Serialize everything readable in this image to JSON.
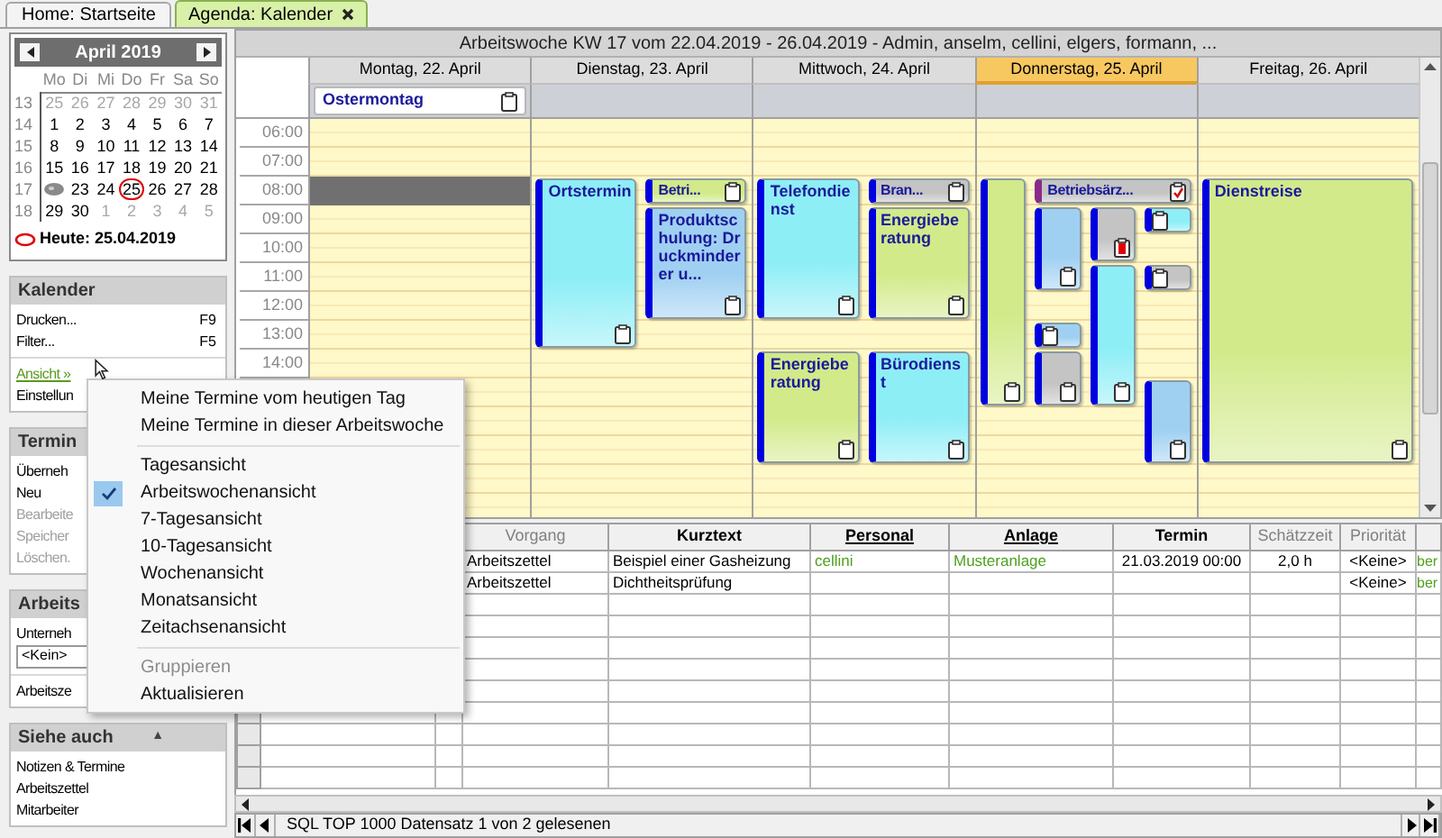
{
  "tabs": [
    {
      "label": "Home: Startseite",
      "selected": false,
      "closable": false
    },
    {
      "label": "Agenda: Kalender",
      "selected": true,
      "closable": true
    }
  ],
  "sidebar": {
    "mini_calendar": {
      "title": "April 2019",
      "weekdays": [
        "Mo",
        "Di",
        "Mi",
        "Do",
        "Fr",
        "Sa",
        "So"
      ],
      "weeks": [
        {
          "week": "13",
          "days": [
            {
              "kind": "day",
              "text": "25",
              "muted": true,
              "today": false
            },
            {
              "kind": "day",
              "text": "26",
              "muted": true,
              "today": false
            },
            {
              "kind": "day",
              "text": "27",
              "muted": true,
              "today": false
            },
            {
              "kind": "day",
              "text": "28",
              "muted": true,
              "today": false
            },
            {
              "kind": "day",
              "text": "29",
              "muted": true,
              "today": false
            },
            {
              "kind": "day",
              "text": "30",
              "muted": true,
              "today": false
            },
            {
              "kind": "day",
              "text": "31",
              "muted": true,
              "today": false
            }
          ]
        },
        {
          "week": "14",
          "days": [
            {
              "kind": "day",
              "text": "1",
              "muted": false,
              "today": false
            },
            {
              "kind": "day",
              "text": "2",
              "muted": false,
              "today": false
            },
            {
              "kind": "day",
              "text": "3",
              "muted": false,
              "today": false
            },
            {
              "kind": "day",
              "text": "4",
              "muted": false,
              "today": false
            },
            {
              "kind": "day",
              "text": "5",
              "muted": false,
              "today": false
            },
            {
              "kind": "day",
              "text": "6",
              "muted": false,
              "today": false
            },
            {
              "kind": "day",
              "text": "7",
              "muted": false,
              "today": false
            }
          ]
        },
        {
          "week": "15",
          "days": [
            {
              "kind": "day",
              "text": "8",
              "muted": false,
              "today": false
            },
            {
              "kind": "day",
              "text": "9",
              "muted": false,
              "today": false
            },
            {
              "kind": "day",
              "text": "10",
              "muted": false,
              "today": false
            },
            {
              "kind": "day",
              "text": "11",
              "muted": false,
              "today": false
            },
            {
              "kind": "day",
              "text": "12",
              "muted": false,
              "today": false
            },
            {
              "kind": "day",
              "text": "13",
              "muted": false,
              "today": false
            },
            {
              "kind": "day",
              "text": "14",
              "muted": false,
              "today": false
            }
          ]
        },
        {
          "week": "16",
          "days": [
            {
              "kind": "day",
              "text": "15",
              "muted": false,
              "today": false
            },
            {
              "kind": "day",
              "text": "16",
              "muted": false,
              "today": false
            },
            {
              "kind": "day",
              "text": "17",
              "muted": false,
              "today": false
            },
            {
              "kind": "day",
              "text": "18",
              "muted": false,
              "today": false
            },
            {
              "kind": "day",
              "text": "19",
              "muted": false,
              "today": false
            },
            {
              "kind": "day",
              "text": "20",
              "muted": false,
              "today": false
            },
            {
              "kind": "day",
              "text": "21",
              "muted": false,
              "today": false
            }
          ]
        },
        {
          "week": "17",
          "days": [
            {
              "kind": "marker"
            },
            {
              "kind": "day",
              "text": "23",
              "muted": false,
              "today": false
            },
            {
              "kind": "day",
              "text": "24",
              "muted": false,
              "today": false
            },
            {
              "kind": "day",
              "text": "25",
              "muted": false,
              "today": true
            },
            {
              "kind": "day",
              "text": "26",
              "muted": false,
              "today": false
            },
            {
              "kind": "day",
              "text": "27",
              "muted": false,
              "today": false
            },
            {
              "kind": "day",
              "text": "28",
              "muted": false,
              "today": false
            }
          ]
        },
        {
          "week": "18",
          "days": [
            {
              "kind": "day",
              "text": "29",
              "muted": false,
              "today": false
            },
            {
              "kind": "day",
              "text": "30",
              "muted": false,
              "today": false
            },
            {
              "kind": "day",
              "text": "1",
              "muted": true,
              "today": false
            },
            {
              "kind": "day",
              "text": "2",
              "muted": true,
              "today": false
            },
            {
              "kind": "day",
              "text": "3",
              "muted": true,
              "today": false
            },
            {
              "kind": "day",
              "text": "4",
              "muted": true,
              "today": false
            },
            {
              "kind": "day",
              "text": "5",
              "muted": true,
              "today": false
            }
          ]
        }
      ],
      "today_label": "Heute: 25.04.2019"
    },
    "sections": [
      {
        "title": "Kalender",
        "groups": [
          [
            {
              "kind": "action",
              "text": "Drucken...",
              "shortcut": "F9",
              "disabled": false
            },
            {
              "kind": "action",
              "text": "Filter...",
              "shortcut": "F5",
              "disabled": false
            }
          ],
          [
            {
              "kind": "link",
              "text": "Ansicht »",
              "disabled": false
            },
            {
              "kind": "action",
              "text": "Einstellun",
              "disabled": false
            }
          ]
        ]
      },
      {
        "title": "Termin",
        "groups": [
          [
            {
              "kind": "action",
              "text": "Überneh",
              "disabled": false
            },
            {
              "kind": "action",
              "text": "Neu",
              "disabled": false
            },
            {
              "kind": "action",
              "text": "Bearbeite",
              "disabled": true
            },
            {
              "kind": "action",
              "text": "Speicher",
              "disabled": true
            },
            {
              "kind": "action",
              "text": "Löschen.",
              "disabled": true
            }
          ]
        ]
      },
      {
        "title": "Arbeits",
        "groups": [
          [
            {
              "kind": "label",
              "text": "Unterneh"
            },
            {
              "kind": "field",
              "value": "<Kein>"
            }
          ],
          [
            {
              "kind": "label",
              "text": "Arbeitsze"
            }
          ]
        ]
      },
      {
        "title": "Siehe auch",
        "toggle": "▲",
        "groups": [
          [
            {
              "kind": "action",
              "text": "Notizen & Termine",
              "disabled": false
            },
            {
              "kind": "action",
              "text": "Arbeitszettel",
              "disabled": false
            },
            {
              "kind": "action",
              "text": "Mitarbeiter",
              "disabled": false
            }
          ]
        ]
      }
    ]
  },
  "calendar": {
    "title": "Arbeitswoche KW 17 vom 22.04.2019 - 26.04.2019 - Admin, anselm, cellini, elgers, formann, ...",
    "time_labels": [
      "06:00",
      "07:00",
      "08:00",
      "09:00",
      "10:00",
      "11:00",
      "12:00",
      "13:00",
      "14:00"
    ],
    "days": [
      {
        "label": "Montag, 22. April",
        "today": false,
        "all_day": [
          {
            "title": "Ostermontag"
          }
        ],
        "lanes": [
          [
            {
              "kind": "selection"
            }
          ]
        ]
      },
      {
        "label": "Dienstag, 23. April",
        "today": false,
        "lanes": [
          [
            {
              "kind": "plain",
              "title": "Ortstermin",
              "color": "#8eeef6"
            }
          ],
          [
            {
              "kind": "plain",
              "title": "Betri...",
              "color": "#d2ea8a"
            },
            {
              "kind": "plain",
              "title": "Produktschulung: Druckminderer u...",
              "color": "#9fd0f2"
            }
          ]
        ]
      },
      {
        "label": "Mittwoch, 24. April",
        "today": false,
        "lanes": [
          [
            {
              "kind": "plain",
              "title": "Telefondienst",
              "color": "#8eeef6"
            },
            {
              "kind": "plain",
              "title": "Energieberatung",
              "color": "#d2ea8a"
            }
          ],
          [
            {
              "kind": "plain",
              "title": "Bran...",
              "color": "#c4c4c4"
            },
            {
              "kind": "plain",
              "title": "Energieberatung",
              "color": "#d2ea8a"
            },
            {
              "kind": "plain",
              "title": "Bürodienst",
              "color": "#8eeef6"
            }
          ]
        ]
      },
      {
        "label": "Donnerstag, 25. April",
        "today": true,
        "lanes": [
          [
            {
              "kind": "plain",
              "color": "#d2ea8a"
            }
          ],
          [
            {
              "kind": "confirmed",
              "title": "Betriebsärz...",
              "color": "#c4c4c4"
            },
            {
              "kind": "plain",
              "color": "#9fd0f2"
            },
            {
              "kind": "plain",
              "color": "#9fd0f2"
            },
            {
              "kind": "plain",
              "color": "#c4c4c4"
            }
          ],
          [
            {
              "kind": "flagged",
              "color": "#c4c4c4"
            },
            {
              "kind": "plain",
              "color": "#8eeef6"
            }
          ],
          [
            {
              "kind": "plain",
              "color": "#8eeef6"
            },
            {
              "kind": "plain",
              "color": "#c4c4c4"
            },
            {
              "kind": "plain",
              "color": "#9fd0f2"
            }
          ]
        ]
      },
      {
        "label": "Freitag, 26. April",
        "today": false,
        "lanes": [
          [
            {
              "kind": "plain",
              "title": "Dienstreise",
              "color": "#d2ea8a"
            }
          ]
        ]
      }
    ]
  },
  "table": {
    "columns": [
      null,
      null,
      "Vorgang",
      "Kurztext",
      "Personal",
      "Anlage",
      "Termin",
      "Schätzzeit",
      "Priorität",
      null
    ],
    "rows": [
      {
        "cells": [
          null,
          null,
          "Arbeitszettel",
          "Beispiel einer Gasheizung",
          "cellini",
          "Musteranlage",
          "21.03.2019 00:00",
          "2,0 h",
          "<Keine>",
          "ber"
        ]
      },
      {
        "cells": [
          null,
          null,
          "Arbeitszettel",
          "Dichtheitsprüfung",
          null,
          null,
          null,
          null,
          "<Keine>",
          "ber"
        ]
      }
    ]
  },
  "status_bar": {
    "text": "SQL TOP 1000 Datensatz 1 von 2 gelesenen"
  },
  "menu": {
    "items": [
      {
        "kind": "item",
        "text": "Meine Termine vom heutigen Tag",
        "checked": false,
        "disabled": false
      },
      {
        "kind": "item",
        "text": "Meine Termine in dieser Arbeitswoche",
        "checked": false,
        "disabled": false
      },
      {
        "kind": "separator"
      },
      {
        "kind": "item",
        "text": "Tagesansicht",
        "checked": false,
        "disabled": false
      },
      {
        "kind": "item",
        "text": "Arbeitswochenansicht",
        "checked": true,
        "disabled": false
      },
      {
        "kind": "item",
        "text": "7-Tagesansicht",
        "checked": false,
        "disabled": false
      },
      {
        "kind": "item",
        "text": "10-Tagesansicht",
        "checked": false,
        "disabled": false
      },
      {
        "kind": "item",
        "text": "Wochenansicht",
        "checked": false,
        "disabled": false
      },
      {
        "kind": "item",
        "text": "Monatsansicht",
        "checked": false,
        "disabled": false
      },
      {
        "kind": "item",
        "text": "Zeitachsenansicht",
        "checked": false,
        "disabled": false
      },
      {
        "kind": "separator"
      },
      {
        "kind": "item",
        "text": "Gruppieren",
        "checked": false,
        "disabled": true
      },
      {
        "kind": "item",
        "text": "Aktualisieren",
        "checked": false,
        "disabled": false
      }
    ]
  }
}
